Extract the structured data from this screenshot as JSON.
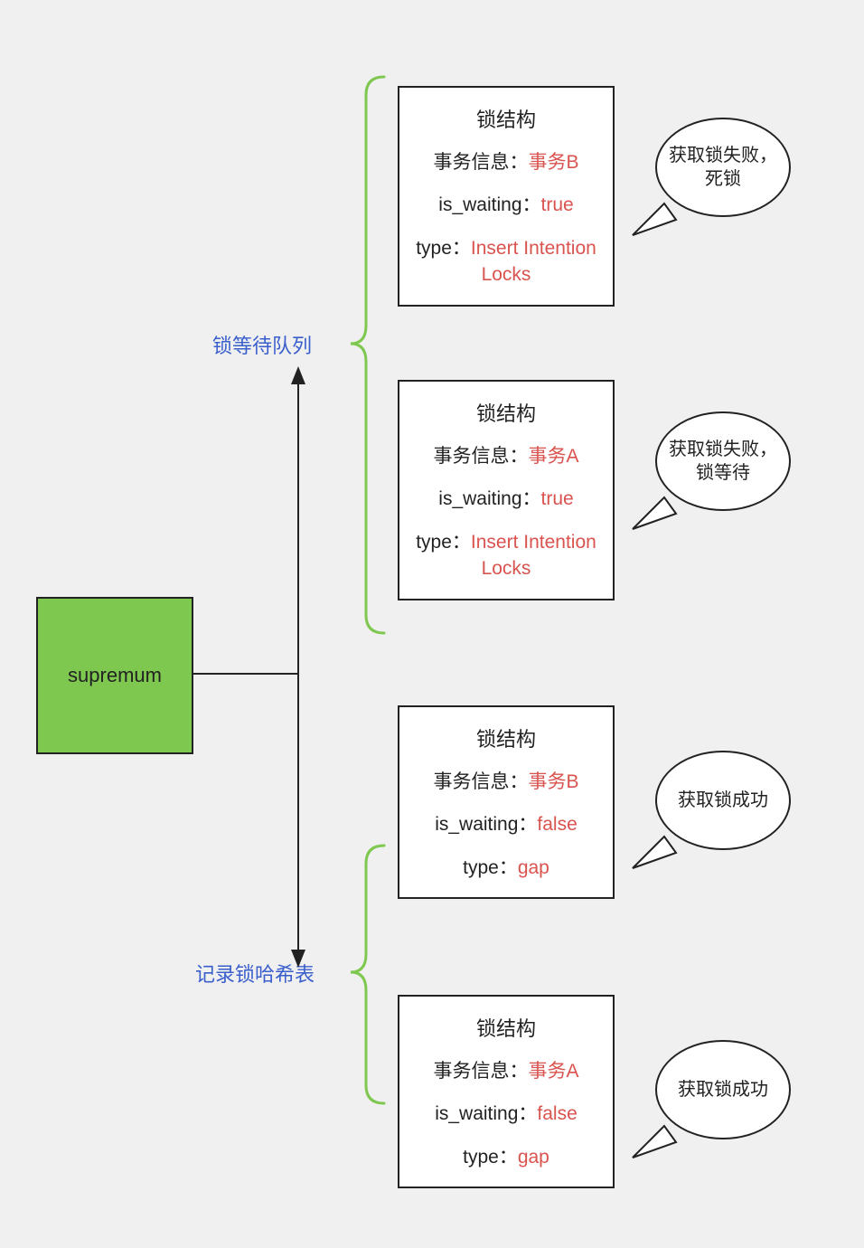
{
  "supremum": {
    "label": "supremum"
  },
  "sections": {
    "waitQueue": "锁等待队列",
    "hashTable": "记录锁哈希表"
  },
  "boxes": {
    "b1": {
      "title": "锁结构",
      "txLabel": "事务信息：",
      "txVal": "事务B",
      "isWaitingLabel": "is_waiting：",
      "isWaitingVal": "true",
      "typeLabel": "type：",
      "typeVal": "Insert Intention Locks"
    },
    "b2": {
      "title": "锁结构",
      "txLabel": "事务信息：",
      "txVal": "事务A",
      "isWaitingLabel": "is_waiting：",
      "isWaitingVal": "true",
      "typeLabel": "type：",
      "typeVal": "Insert Intention Locks"
    },
    "b3": {
      "title": "锁结构",
      "txLabel": "事务信息：",
      "txVal": "事务B",
      "isWaitingLabel": "is_waiting：",
      "isWaitingVal": "false",
      "typeLabel": "type：",
      "typeVal": "gap"
    },
    "b4": {
      "title": "锁结构",
      "txLabel": "事务信息：",
      "txVal": "事务A",
      "isWaitingLabel": "is_waiting：",
      "isWaitingVal": "false",
      "typeLabel": "type：",
      "typeVal": "gap"
    }
  },
  "bubbles": {
    "bub1": "获取锁失败，死锁",
    "bub2": "获取锁失败，锁等待",
    "bub3": "获取锁成功",
    "bub4": "获取锁成功"
  }
}
